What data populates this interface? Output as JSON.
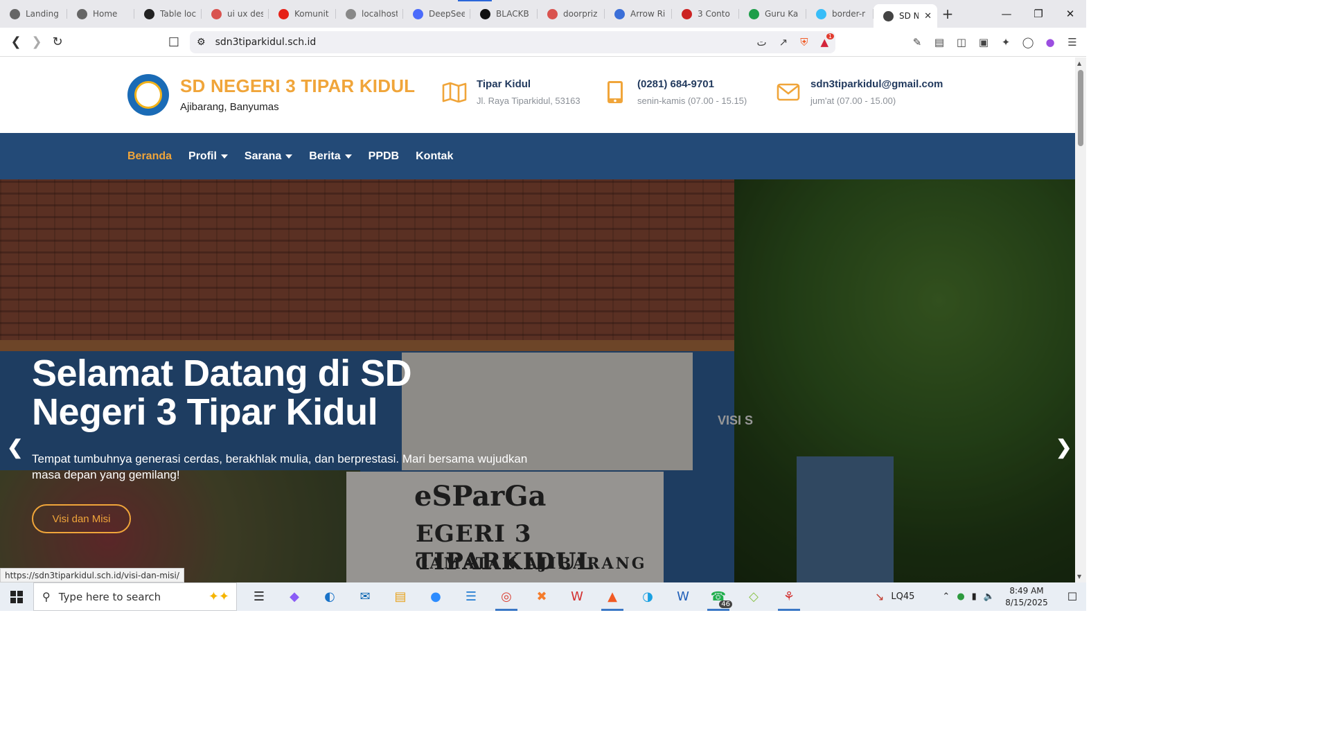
{
  "browser": {
    "tabs": [
      {
        "label": "Landing",
        "icon": "globe-icon",
        "color": "#666"
      },
      {
        "label": "Home",
        "icon": "globe-icon",
        "color": "#666"
      },
      {
        "label": "Table loc",
        "icon": "openai-icon",
        "color": "#222"
      },
      {
        "label": "ui ux des",
        "icon": "shield-icon",
        "color": "#d9534f"
      },
      {
        "label": "Komunit",
        "icon": "youtube-icon",
        "color": "#e62117"
      },
      {
        "label": "localhost",
        "icon": "globe-icon",
        "color": "#888"
      },
      {
        "label": "DeepSee",
        "icon": "deepseek-icon",
        "color": "#4b6bfb"
      },
      {
        "label": "BLACKB",
        "icon": "blackbox-icon",
        "color": "#111"
      },
      {
        "label": "doorpriz",
        "icon": "shield-icon",
        "color": "#d9534f"
      },
      {
        "label": "Arrow Ri",
        "icon": "arrow-icon",
        "color": "#3b6fd8"
      },
      {
        "label": "3 Conto",
        "icon": "alert-icon",
        "color": "#c22"
      },
      {
        "label": "Guru Ka",
        "icon": "sheet-icon",
        "color": "#1e9e4a"
      },
      {
        "label": "border-r",
        "icon": "tailwind-icon",
        "color": "#38bdf8"
      },
      {
        "label": "SD N",
        "icon": "globe-icon",
        "color": "#444"
      }
    ],
    "address": "sdn3tiparkidul.sch.id",
    "badge_count": "1",
    "status_url": "https://sdn3tiparkidul.sch.id/visi-dan-misi/"
  },
  "site": {
    "name": "SD NEGERI 3 TIPAR KIDUL",
    "location": "Ajibarang, Banyumas",
    "info": [
      {
        "icon": "map-icon",
        "title": "Tipar Kidul",
        "detail": "Jl. Raya Tiparkidul, 53163"
      },
      {
        "icon": "phone-icon",
        "title": "(0281) 684-9701",
        "detail": "senin-kamis (07.00 - 15.15)"
      },
      {
        "icon": "mail-icon",
        "title": "sdn3tiparkidul@gmail.com",
        "detail": "jum'at (07.00 - 15.00)"
      }
    ],
    "nav": [
      {
        "label": "Beranda",
        "dropdown": false,
        "active": true
      },
      {
        "label": "Profil",
        "dropdown": true,
        "active": false
      },
      {
        "label": "Sarana",
        "dropdown": true,
        "active": false
      },
      {
        "label": "Berita",
        "dropdown": true,
        "active": false
      },
      {
        "label": "PPDB",
        "dropdown": false,
        "active": false
      },
      {
        "label": "Kontak",
        "dropdown": false,
        "active": false
      }
    ],
    "hero": {
      "title": "Selamat Datang di SD Negeri 3 Tipar Kidul",
      "subtitle": "Tempat tumbuhnya generasi cerdas, berakhlak mulia, dan berprestasi. Mari bersama wujudkan masa depan yang gemilang!",
      "button": "Visi dan Misi",
      "sign_line1": "eSParGa",
      "sign_line2": "EGERI 3 TIPARKIDUL",
      "sign_line3": "CAMATAN AJIBARANG",
      "sign_side": "VISI S"
    },
    "colors": {
      "accent": "#f0a53a",
      "navbar": "#234a77",
      "heading": "#223a5e"
    }
  },
  "taskbar": {
    "search_placeholder": "Type here to search",
    "apps": [
      "task-view-icon",
      "copilot-icon",
      "edge-icon",
      "outlook-icon",
      "file-explorer-icon",
      "zoom-icon",
      "vscode-icon",
      "chrome-icon",
      "xampp-icon",
      "wps-icon",
      "brave-icon",
      "edge-dev-icon",
      "word-icon",
      "whatsapp-icon",
      "gem-icon",
      "app-icon"
    ],
    "whatsapp_badge": "46",
    "stock": "LQ45",
    "time": "8:49 AM",
    "date": "8/15/2025"
  }
}
